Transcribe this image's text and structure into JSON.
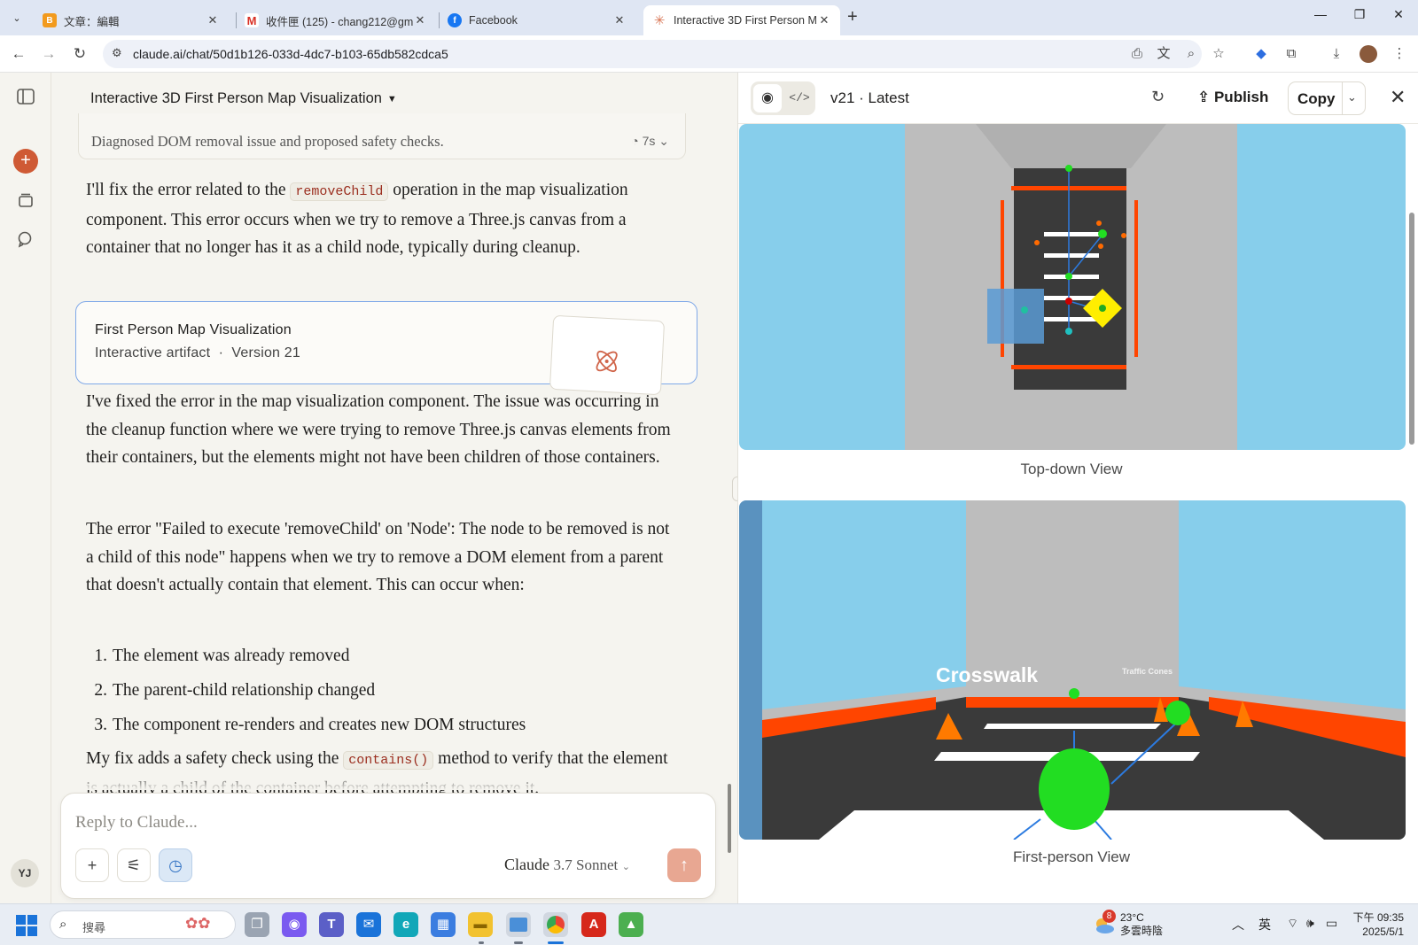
{
  "browser": {
    "tabs": [
      {
        "title": "文章：編輯",
        "favicon": "blogger-icon"
      },
      {
        "title": "收件匣 (125) - chang212@gm",
        "favicon": "gmail-icon"
      },
      {
        "title": "Facebook",
        "favicon": "facebook-icon"
      },
      {
        "title": "Interactive 3D First Person Ma",
        "favicon": "claude-icon"
      }
    ],
    "url": "claude.ai/chat/50d1b126-033d-4dc7-b103-65db582cdca5"
  },
  "rail": {
    "user_initials": "YJ"
  },
  "chat": {
    "title": "Interactive 3D First Person Map Visualization",
    "thinking_summary": "Diagnosed DOM removal issue and proposed safety checks.",
    "thinking_duration": "7s",
    "p1_before": "I'll fix the error related to the ",
    "p1_code": "removeChild",
    "p1_after": " operation in the map visualization component. This error occurs when we try to remove a Three.js canvas from a container that no longer has it as a child node, typically during cleanup.",
    "artifact_name": "First Person Map Visualization",
    "artifact_type": "Interactive artifact",
    "artifact_version": "Version 21",
    "p2": "I've fixed the error in the map visualization component. The issue was occurring in the cleanup function where we were trying to remove Three.js canvas elements from their containers, but the elements might not have been children of those containers.",
    "p3": "The error \"Failed to execute 'removeChild' on 'Node': The node to be removed is not a child of this node\" happens when we try to remove a DOM element from a parent that doesn't actually contain that element. This can occur when:",
    "list": [
      {
        "num": "1.",
        "text": "The element was already removed"
      },
      {
        "num": "2.",
        "text": "The parent-child relationship changed"
      },
      {
        "num": "3.",
        "text": "The component re-renders and creates new DOM structures"
      }
    ],
    "p4_before": "My fix adds a safety check using the ",
    "p4_code": "contains()",
    "p4_after": " method to verify that the element is actually a child of the container before attempting to remove it.",
    "composer_placeholder": "Reply to Claude...",
    "model_name": "Claude",
    "model_version": "3.7 Sonnet"
  },
  "panel": {
    "version_label": "v21 · Latest",
    "publish_label": "Publish",
    "copy_label": "Copy",
    "top_view_caption": "Top-down View",
    "fp_view_caption": "First-person View",
    "scene_label_crosswalk": "Crosswalk",
    "scene_label_cones": "Traffic Cones"
  },
  "taskbar": {
    "search_placeholder": "搜尋",
    "weather_temp": "23°C",
    "weather_desc": "多雲時陰",
    "weather_badge": "8",
    "ime": "英",
    "time": "下午 09:35",
    "date": "2025/5/1"
  },
  "colors": {
    "claude_orange": "#cf5a35",
    "artifact_border": "#7fa8e8",
    "sky": "#87ceeb",
    "road": "#3a3a3a",
    "barrier": "#ff4500",
    "marker_green": "#22dd22",
    "marker_yellow": "#ffee00"
  }
}
